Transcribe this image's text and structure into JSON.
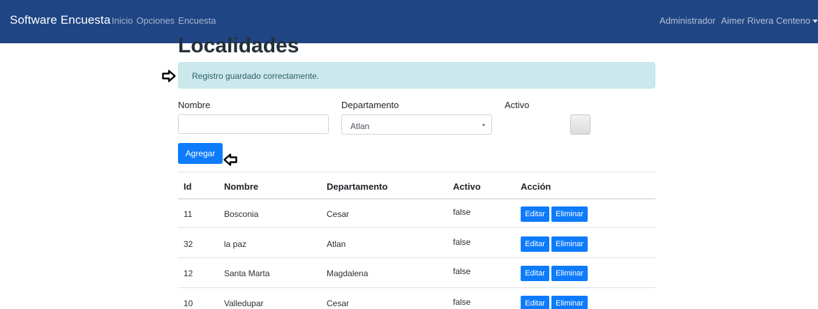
{
  "navbar": {
    "brand": "Software Encuesta",
    "links": [
      "Inicio",
      "Opciones",
      "Encuesta"
    ],
    "right_links": [
      "Administrador",
      "Aimer Rivera Centeno"
    ]
  },
  "page": {
    "title": "Localidades",
    "alert": "Registro guardado correctamente."
  },
  "form": {
    "nombre_label": "Nombre",
    "nombre_value": "",
    "departamento_label": "Departamento",
    "departamento_value": "Atlan",
    "activo_label": "Activo",
    "activo_checked": false,
    "agregar_label": "Agregar"
  },
  "table": {
    "headers": [
      "Id",
      "Nombre",
      "Departamento",
      "Activo",
      "Acción"
    ],
    "rows": [
      {
        "id": "11",
        "nombre": "Bosconia",
        "departamento": "Cesar",
        "activo": "false"
      },
      {
        "id": "32",
        "nombre": "la paz",
        "departamento": "Atlan",
        "activo": "false"
      },
      {
        "id": "12",
        "nombre": "Santa Marta",
        "departamento": "Magdalena",
        "activo": "false"
      },
      {
        "id": "10",
        "nombre": "Valledupar",
        "departamento": "Cesar",
        "activo": "false"
      }
    ],
    "edit_label": "Editar",
    "delete_label": "Eliminar"
  },
  "icons": {
    "alert_arrow": "arrow-right-icon",
    "button_arrow": "arrow-left-icon"
  },
  "colors": {
    "navbar": "#1f4584",
    "primary": "#0d7bfb",
    "alert_bg": "#cbe9ed"
  }
}
